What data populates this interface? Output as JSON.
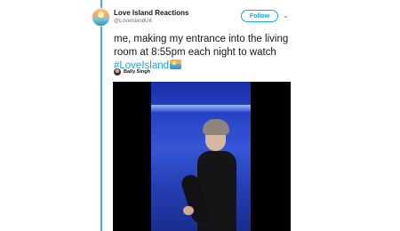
{
  "tweet": {
    "author_name": "Love Island Reactions",
    "author_handle": "@LoveIslandUK",
    "follow_label": "Follow",
    "text_main": "me, making my entrance into the living room at 8:55pm each night to watch",
    "hashtag": "#LoveIsland",
    "tagged_user": "Bally Singh"
  },
  "icons": {
    "more": "chevron-down-icon",
    "emoji": "sunset-emoji-icon"
  },
  "colors": {
    "accent": "#1da1f2",
    "thread_line": "#4aabe8",
    "text": "#14171a",
    "muted": "#657786"
  }
}
